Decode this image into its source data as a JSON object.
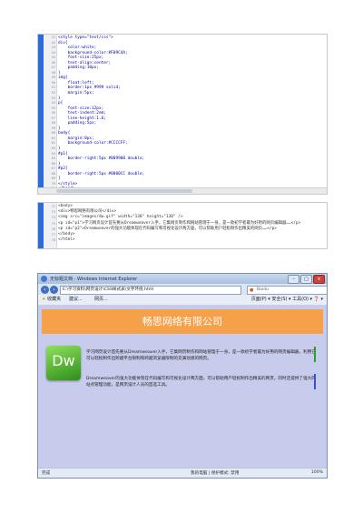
{
  "css_editor": {
    "lines": [
      {
        "n": "41",
        "t": "<style type=\"text/css\">"
      },
      {
        "n": "42",
        "t": "div{"
      },
      {
        "n": "43",
        "t": "    color:white;"
      },
      {
        "n": "44",
        "t": "    background-color:#F09C4A;"
      },
      {
        "n": "45",
        "t": "    font-size:25px;"
      },
      {
        "n": "46",
        "t": "    text-align:center;"
      },
      {
        "n": "47",
        "t": "    padding:10px;"
      },
      {
        "n": "48",
        "t": "}"
      },
      {
        "n": "49",
        "t": "img{"
      },
      {
        "n": "50",
        "t": "    float:left;"
      },
      {
        "n": "51",
        "t": "    border:1px #999 solid;"
      },
      {
        "n": "52",
        "t": "    margin:5px;"
      },
      {
        "n": "53",
        "t": "}"
      },
      {
        "n": "54",
        "t": "p{"
      },
      {
        "n": "55",
        "t": "    font-size:12px;"
      },
      {
        "n": "56",
        "t": "    text-indent:2em;"
      },
      {
        "n": "57",
        "t": "    line-height:1.6;"
      },
      {
        "n": "58",
        "t": "    padding:5px;"
      },
      {
        "n": "59",
        "t": "}"
      },
      {
        "n": "60",
        "t": "body{"
      },
      {
        "n": "61",
        "t": "    margin:0px;"
      },
      {
        "n": "62",
        "t": "    background-color:#CCCCFF;"
      },
      {
        "n": "63",
        "t": "}"
      },
      {
        "n": "64",
        "t": "#p1{"
      },
      {
        "n": "65",
        "t": "    border-right:5px #009900 double;"
      },
      {
        "n": "66",
        "t": "}"
      },
      {
        "n": "67",
        "t": "#p2{"
      },
      {
        "n": "68",
        "t": "    border-right:5px #0000CC double;"
      },
      {
        "n": "69",
        "t": "}"
      },
      {
        "n": "70",
        "t": "</style>"
      },
      {
        "n": "71",
        "t": "</head>"
      }
    ]
  },
  "html_editor": {
    "lines": [
      {
        "n": "72",
        "t": "<body>"
      },
      {
        "n": "73",
        "t": "<div>畅思网络有限公司</div>"
      },
      {
        "n": "74",
        "t": "<img src=\"images/dw.gif\" width=\"130\" height=\"130\" />"
      },
      {
        "n": "75",
        "t": "<p id=\"p1\">学习网页设计首先要从Dreamweaver入手，它集网页制作和网站管理于一身，是一款初学者最为好用的网页编辑器……</p>"
      },
      {
        "n": "76",
        "t": "<p id=\"p2\">Dreamweaver的强大功能体现在代码编写和可视化设计两方面，可以帮助用户轻松制作出精美的网页……</p>"
      },
      {
        "n": "77",
        "t": "</body>"
      },
      {
        "n": "78",
        "t": "</html>"
      }
    ]
  },
  "browser": {
    "window_title": "无标题文档 - Windows Internet Explorer",
    "address": "E:\\学习资料\\网页设计\\CSS样式表\\文字环绕.html",
    "search_placeholder": "Baidu",
    "favorites": [
      {
        "label": "收藏夹"
      },
      {
        "label": "建议..."
      },
      {
        "label": "网页..."
      }
    ],
    "tools_label": "页面(P) ▾ 安全(S) ▾ 工具(O) ▾ ❓ ▾",
    "banner_text": "畅思网络有限公司",
    "logo_text": "Dw",
    "paragraph1": "学习网页设计首先要从Dreamweaver入手，它集网页制作和网站管理于一身，是一款初学者最为好用的网页编辑器，利用它可以轻松制作出跨越平台限制和跨越浏览器限制的充满动感的网页。",
    "paragraph2": "Dreamweaver的强大功能体现在代码编写和可视化设计两方面，可以帮助用户轻松制作出精美的网页，同时还提供了强大的站点管理功能，是网页设计人员的首选工具。",
    "status_left": "完成",
    "status_mid": "我的电脑 | 保护模式: 禁用",
    "zoom": "100%"
  },
  "colors": {
    "banner": "#F5A14A",
    "page_bg": "#C8CCEC",
    "p1_border": "#2AA02A",
    "p2_border": "#3A4FD0"
  }
}
